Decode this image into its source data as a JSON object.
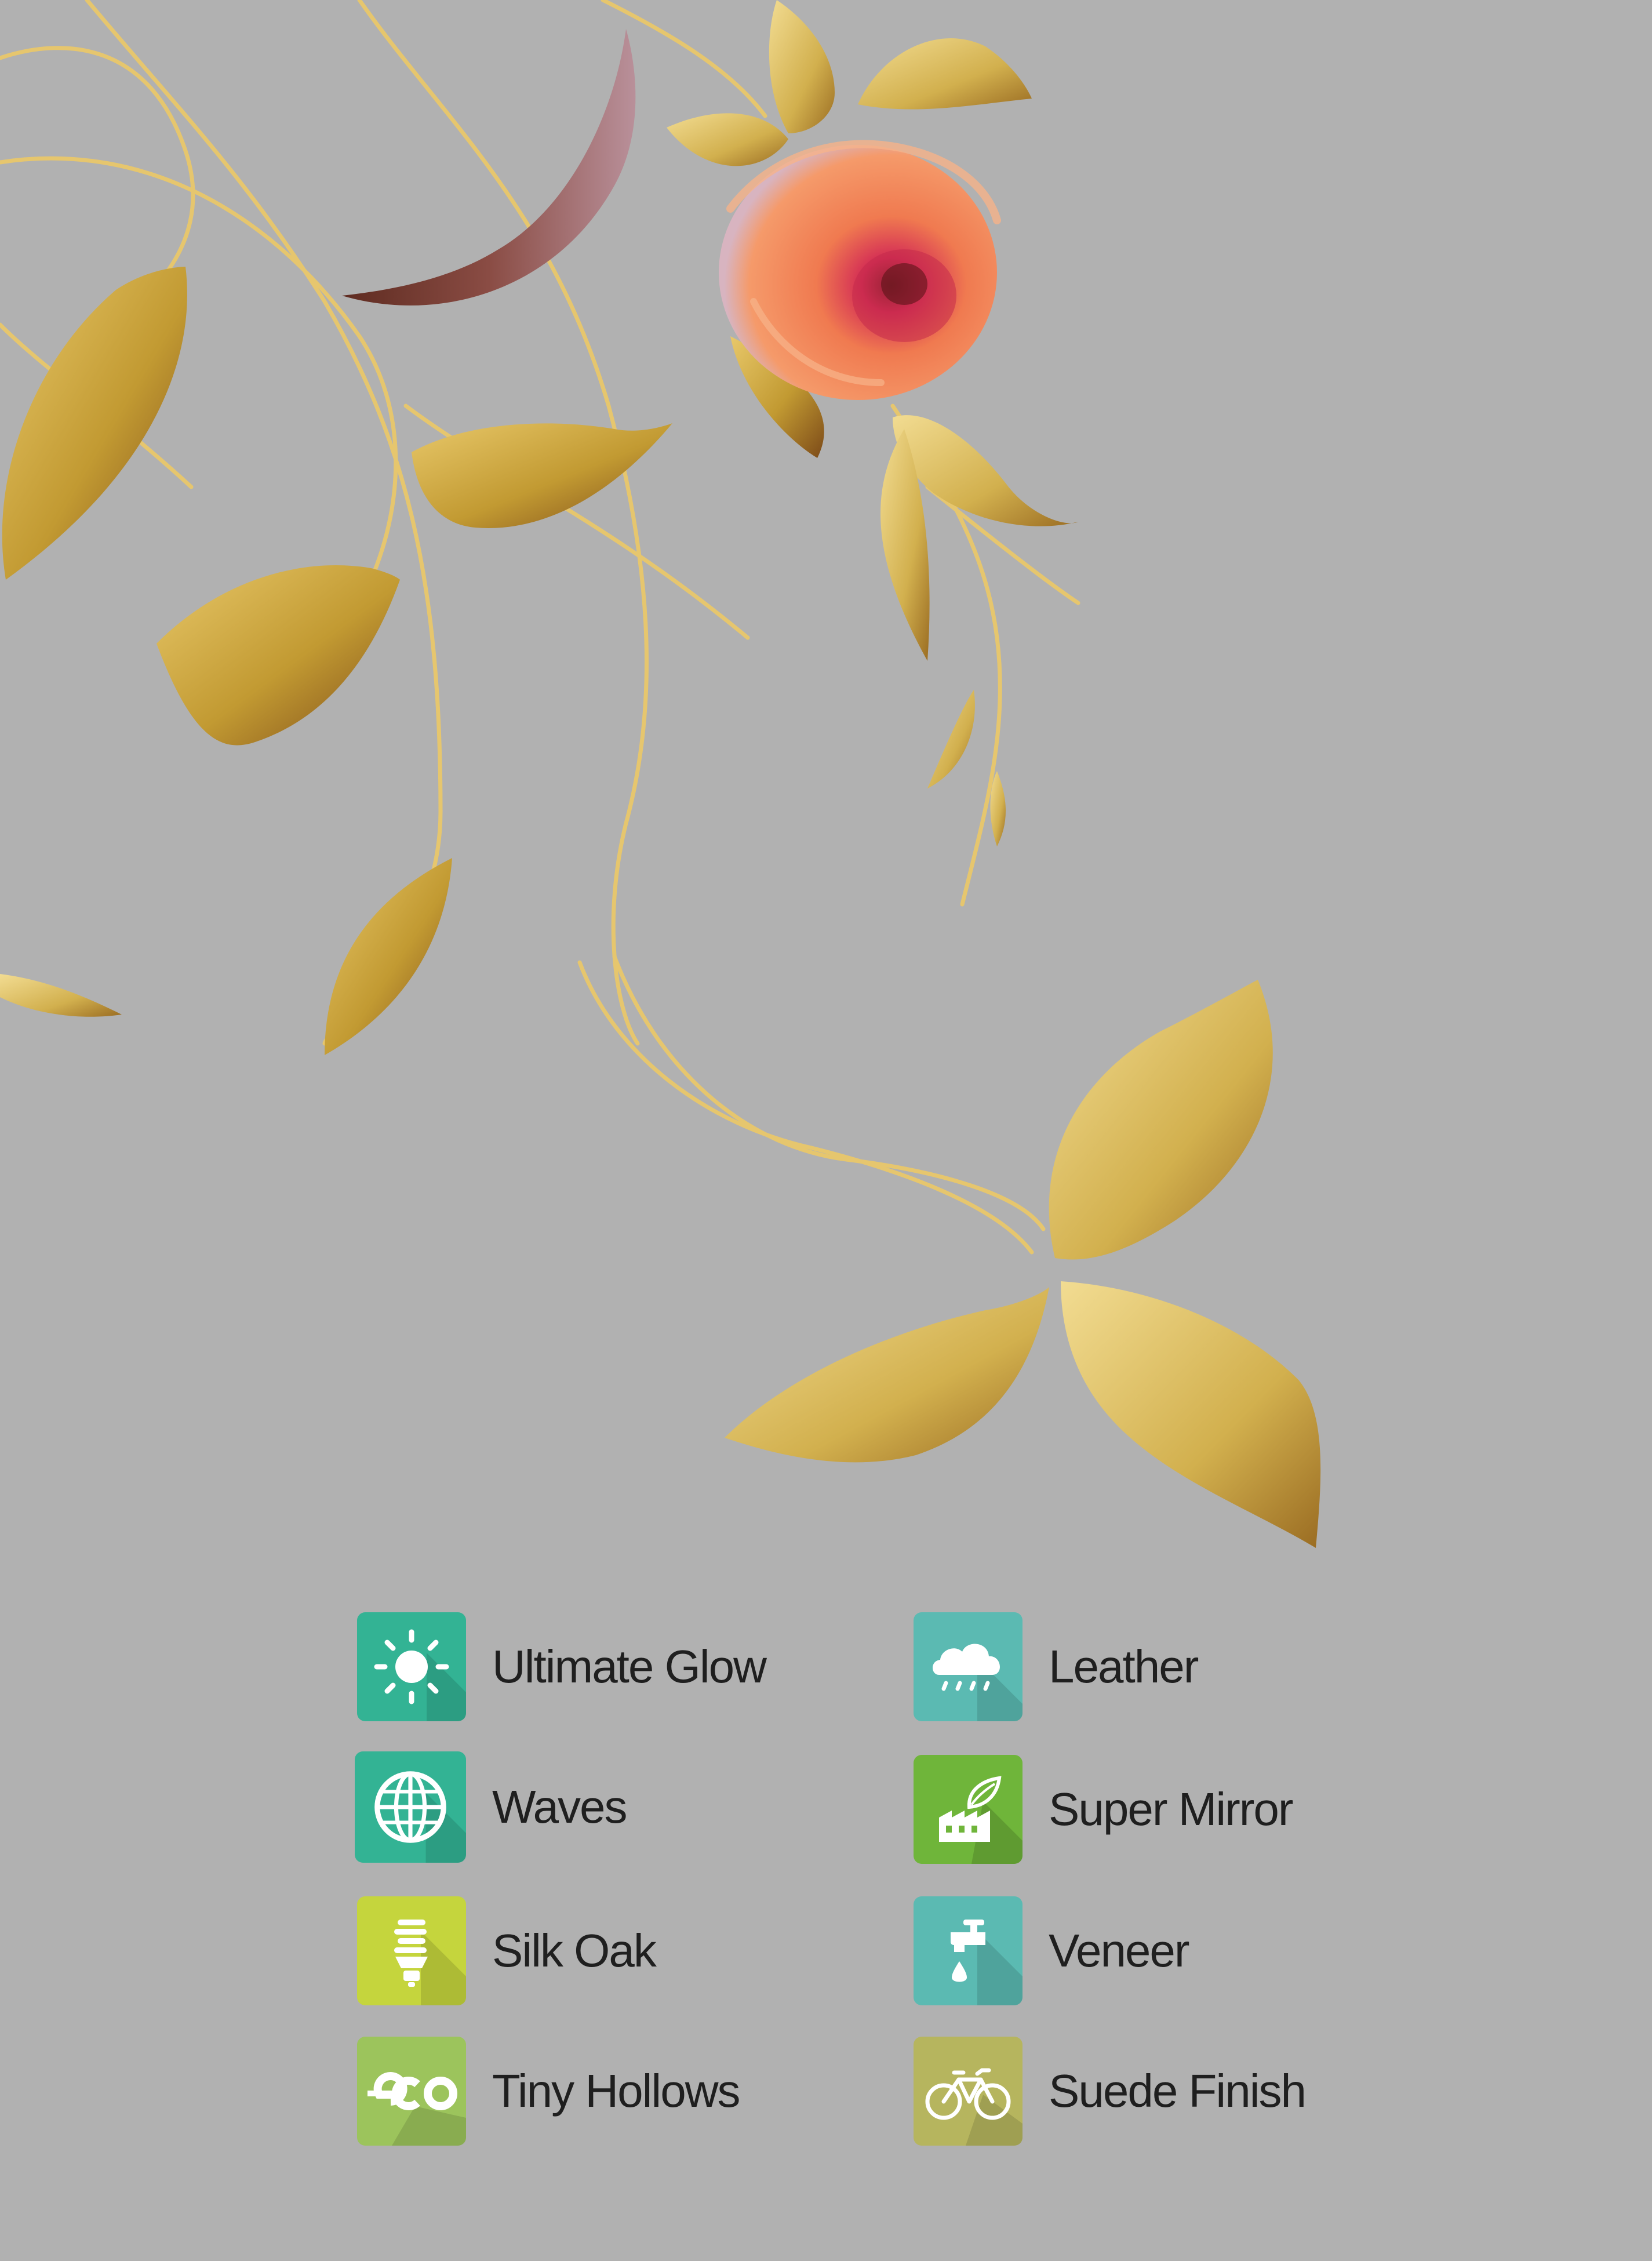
{
  "background_color": "#b1b1b1",
  "palette": {
    "leaf_gold": "#c9a43a",
    "leaf_dark": "#7a4a1a",
    "stem": "#e6c66e",
    "rose": "#f08150",
    "rose_center": "#c8264a"
  },
  "features": [
    {
      "label": "Ultimate Glow",
      "icon": "sun-icon",
      "color": "#33b394"
    },
    {
      "label": "Leather",
      "icon": "rain-cloud-icon",
      "color": "#5bbab2"
    },
    {
      "label": "Waves",
      "icon": "globe-icon",
      "color": "#33b394"
    },
    {
      "label": "Super Mirror",
      "icon": "eco-factory-icon",
      "color": "#6fb53a"
    },
    {
      "label": "Silk Oak",
      "icon": "energy-bulb-icon",
      "color": "#c5d53d"
    },
    {
      "label": "Veneer",
      "icon": "water-tap-icon",
      "color": "#5bbab2"
    },
    {
      "label": "Tiny Hollows",
      "icon": "eco-icon",
      "color": "#9cc45c"
    },
    {
      "label": "Suede Finish",
      "icon": "bicycle-icon",
      "color": "#b6b55e"
    }
  ]
}
